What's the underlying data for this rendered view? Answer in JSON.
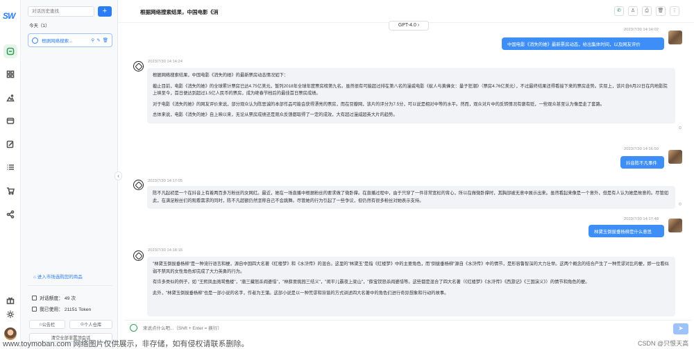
{
  "app": {
    "logo_text": "SW",
    "watermark": "www.toymoban.com 网络图片仅供展示，非存储，如有侵权请联系删除。",
    "credit": "CSDN @只恨天高"
  },
  "rail": {
    "items": [
      {
        "name": "chat-icon",
        "active": true
      },
      {
        "name": "apps-icon",
        "active": false
      },
      {
        "name": "image-icon",
        "active": false
      },
      {
        "name": "box-icon",
        "active": false
      },
      {
        "name": "edit-icon",
        "active": false
      },
      {
        "name": "list-icon",
        "active": false
      },
      {
        "name": "cart-icon",
        "active": false
      },
      {
        "name": "share-icon",
        "active": false
      }
    ],
    "bottom": [
      "gift-icon",
      "sun-icon",
      "avatar"
    ]
  },
  "sidebar": {
    "search_placeholder": "对话历史查找",
    "add_label": "+",
    "group_label": "今天（1）",
    "history": [
      {
        "title": "根据网络搜索...",
        "active": true
      }
    ],
    "market_link": "进入市场选购您的商品",
    "quota_label": "对话额度： 49 次",
    "used_label": "我已使用： 21151 Token",
    "notice_button": "公告栏",
    "profile_button": "个人仓库",
    "clear_button": "清空全部非置顶会话"
  },
  "header": {
    "title": "根据网络搜索结果，中国电影《消",
    "model": "GPT-4.0"
  },
  "messages": [
    {
      "role": "user",
      "time": "2023/7/30 14:14:02",
      "text": "中国电影《消失的她》最新票房动态，给出集体时间，以及网友评价"
    },
    {
      "role": "assistant",
      "time": "2023/7/30 14:14:24",
      "paragraphs": [
        "根据网络搜索结果，中国电影《消失的她》的最新票房动态情况如下：",
        "截止目前，电影《消失的她》的全球累计票房已达4.75亿美元，暂列2018年全球年度票房榜第九名。虽然很有可能超过排在第八名的漫威电影《蚁人与黄蜂女：量子狂潮》（票房4.76亿美元），不过最终结果还得看接下来的票房走势。实际上，该片自6月22日在内地影院上映至今，首日便达到超过1.5亿人民币的票房，成为继春节档后的最佳首日票房成绩。",
        "对于电影《消失的她》的网友评价来说，部分观众认为陈思诚的本部作品可能会获得漂亮的票房，而在豆瓣网，该片的评分为7.5分，可以说是相对中等的水平。然而，观众对片中的反转情况有褒有贬，一些观众甚至认为像是走了套路。",
        "总体来说，电影《消失的她》自上映以来，无论从票房成绩还是观众反馈都取得了一定的成效，大有超过漫威超英大片的趋势。"
      ]
    },
    {
      "role": "user",
      "time": "2023/7/30 14:16:50",
      "text": "抖音陈不凡事件"
    },
    {
      "role": "assistant",
      "time": "2023/7/30 14:17:05",
      "paragraphs": [
        "陈不凡起初是一个在抖音上有着两百多万粉丝的女网红。最近，她在一场直播中根据粉丝的要求做了微卧撑。在直播过程中，由于只穿了一件非常宽松的背心，所以在做微卧撑时，其胸部被无意中展示出来。虽然看起来像是一个意外，但是有人认为她是故意的。尽管如此，在满足粉丝们的观看需求的同时，陈不凡超额仍然坚称自己不会跳舞。尽管她的行为引起了一些争议，但仍然有很多粉丝对她表示支持。"
      ]
    },
    {
      "role": "user",
      "time": "2023/7/30 14:17:48",
      "text": "林黛玉倒拔垂杨柳是什么意思"
    },
    {
      "role": "assistant",
      "time": "2023/7/30 14:18:15",
      "paragraphs": [
        "\"林黛玉倒拔垂杨柳\"是一种流行语言和梗，源自中国四大名著《红楼梦》和《水浒传》的混合。这里的\"林黛玉\"是指《红楼梦》中的主要角色，而\"倒拔垂杨柳\"源自《水浒传》中的情节，是形容鲁智深的大力壮举。这两个概念的结合产生了一种荒谬对比的梗，即一位看似弱不禁风的女性角色却完成了大力英勇的行为。",
        "有许多类似的例子，如 \"王熙凤血溅鸳鸯楼\"，\"唐三藏怒杀阎婆惜\"，\"林薛贾挑园三结义\"，\"闹平儿霸夜上梁山\"，\"薛宝钗怒杀阎婆惜等。这些都是混合了四大名著（《红楼梦》《水浒传》《西游记》《三国演义》）的情节和角色的梗。",
        "此外，\"林黛玉倒拔垂杨柳\"也是一部小说的名字，作者为王蒲。这部小说是以一种荒谬和诙谐的方式讲述四大名著中的角色们进行奇异想象和行动的故事。"
      ]
    }
  ],
  "input": {
    "placeholder": "来说点什么吧...（Shift + Enter = 换行）",
    "send_label": "➤"
  }
}
